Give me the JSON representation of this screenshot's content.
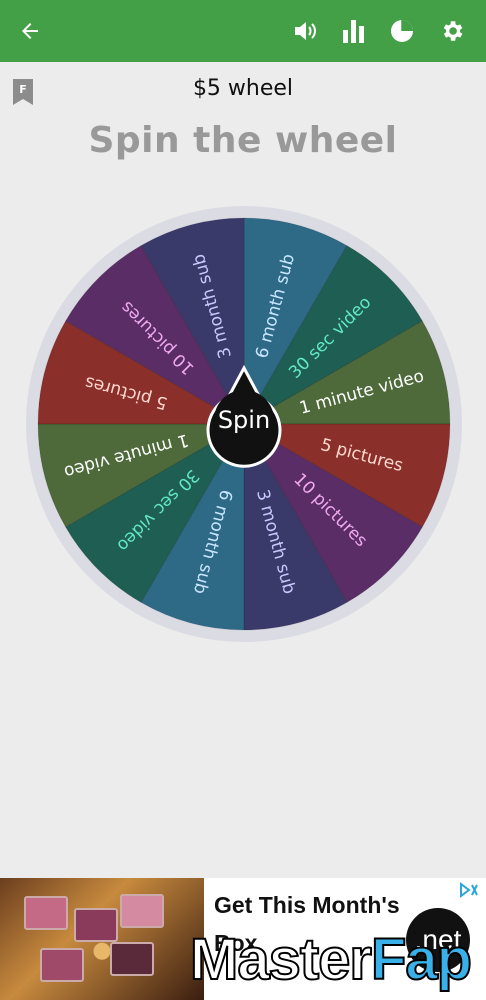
{
  "appbar": {
    "back_icon": "arrow-left-icon",
    "sound_icon": "volume-icon",
    "stats_icon": "bar-chart-icon",
    "pie_icon": "pie-chart-icon",
    "settings_icon": "gear-icon",
    "bar_color": "#43a047"
  },
  "wheel_title": "$5 wheel",
  "headline": "Spin the wheel",
  "bookmark_letter": "F",
  "spin_label": "Spin",
  "wheel": {
    "segments": [
      {
        "label": "6 month sub",
        "color": "#2e6a86",
        "text_color": "#c9e6ff"
      },
      {
        "label": "30 sec video",
        "color": "#1f5e52",
        "text_color": "#62e8c4"
      },
      {
        "label": "1 minute video",
        "color": "#4e6a3a",
        "text_color": "#ffffff"
      },
      {
        "label": "5 pictures",
        "color": "#8a2f2a",
        "text_color": "#ffd9d0"
      },
      {
        "label": "10 pictures",
        "color": "#5a2d66",
        "text_color": "#f0a8f0"
      },
      {
        "label": "3 month sub",
        "color": "#3a3a6a",
        "text_color": "#c8c8ff"
      },
      {
        "label": "6 month sub",
        "color": "#2e6a86",
        "text_color": "#c9e6ff"
      },
      {
        "label": "30 sec video",
        "color": "#1f5e52",
        "text_color": "#62e8c4"
      },
      {
        "label": "1 minute video",
        "color": "#4e6a3a",
        "text_color": "#ffffff"
      },
      {
        "label": "5 pictures",
        "color": "#8a2f2a",
        "text_color": "#ffd9d0"
      },
      {
        "label": "10 pictures",
        "color": "#5a2d66",
        "text_color": "#f0a8f0"
      },
      {
        "label": "3 month sub",
        "color": "#3a3a6a",
        "text_color": "#c8c8ff"
      }
    ]
  },
  "ad": {
    "title": "Get This Month's Box",
    "choices_icon": "ad-choices-icon"
  },
  "watermark": {
    "part1": "Master",
    "part2": "Fap",
    "badge": ".net"
  }
}
